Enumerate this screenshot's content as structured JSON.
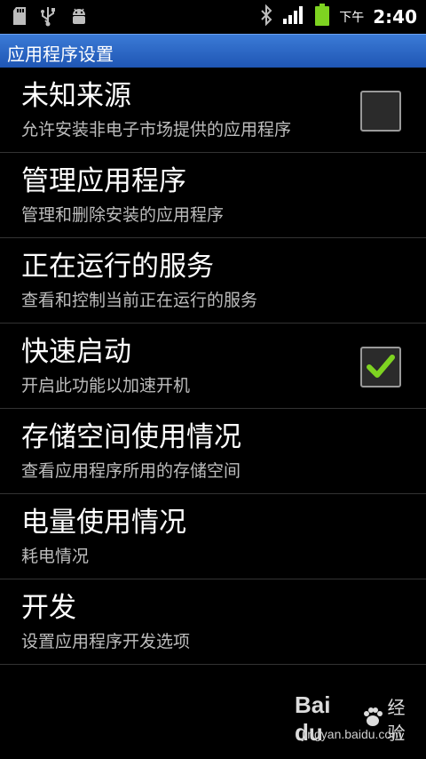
{
  "status_bar": {
    "left_icons": [
      "sd-card-icon",
      "usb-icon",
      "android-debug-icon"
    ],
    "right_icons": [
      "bluetooth-icon",
      "signal-icon",
      "battery-icon"
    ],
    "ampm": "下午",
    "time": "2:40",
    "accent_color": "#7ed321"
  },
  "title_bar": {
    "title": "应用程序设置",
    "background": "#2a64c4"
  },
  "settings": [
    {
      "title": "未知来源",
      "summary": "允许安装非电子市场提供的应用程序",
      "checkbox": true,
      "checked": false
    },
    {
      "title": "管理应用程序",
      "summary": "管理和删除安装的应用程序"
    },
    {
      "title": "正在运行的服务",
      "summary": "查看和控制当前正在运行的服务"
    },
    {
      "title": "快速启动",
      "summary": "开启此功能以加速开机",
      "checkbox": true,
      "checked": true
    },
    {
      "title": "存储空间使用情况",
      "summary": "查看应用程序所用的存储空间"
    },
    {
      "title": "电量使用情况",
      "summary": "耗电情况"
    },
    {
      "title": "开发",
      "summary": "设置应用程序开发选项"
    }
  ],
  "watermark": {
    "brand": "Bai du",
    "suffix": "经验",
    "url": "jingyan.baidu.com"
  }
}
